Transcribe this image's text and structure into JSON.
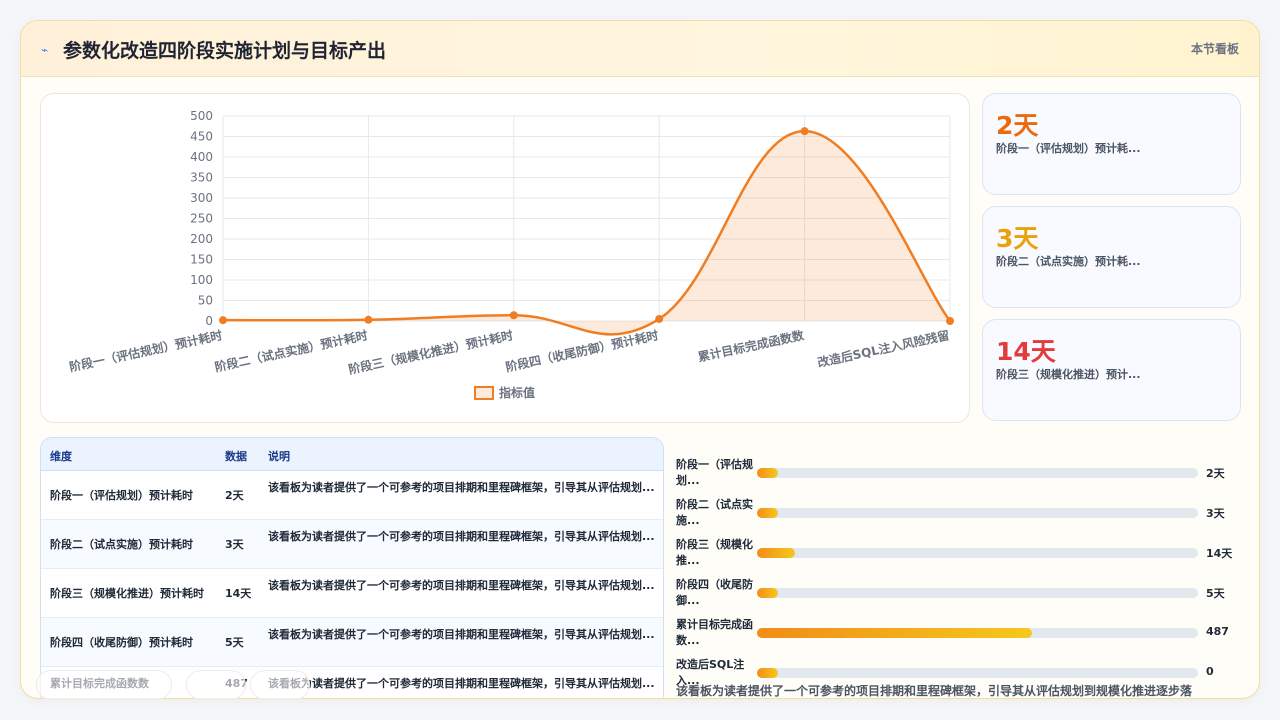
{
  "header": {
    "icon": "lightning-icon",
    "title": "参数化改造四阶段实施计划与目标产出",
    "right_label": "本节看板"
  },
  "chart_data": {
    "type": "line",
    "categories": [
      "阶段一（评估规划）预计耗时",
      "阶段二（试点实施）预计耗时",
      "阶段三（规模化推进）预计耗时",
      "阶段四（收尾防御）预计耗时",
      "累计目标完成函数数",
      "改造后SQL注入风险残留"
    ],
    "series": [
      {
        "name": "指标值",
        "values": [
          2,
          3,
          14,
          5,
          463,
          0
        ]
      }
    ],
    "yticks": [
      "0",
      "50",
      "100",
      "150",
      "200",
      "250",
      "300",
      "350",
      "400",
      "450",
      "500"
    ],
    "ylim": [
      0,
      500
    ],
    "grid": true,
    "legend": "bottom",
    "fill": "area",
    "color": "#f07d22"
  },
  "kpis": [
    {
      "value": "2天",
      "label": "阶段一（评估规划）预计耗...",
      "color": "#ea6a10"
    },
    {
      "value": "3天",
      "label": "阶段二（试点实施）预计耗...",
      "color": "#eaa20c"
    },
    {
      "value": "14天",
      "label": "阶段三（规模化推进）预计...",
      "color": "#e23b3b"
    }
  ],
  "table": {
    "headers": [
      "维度",
      "数据",
      "说明"
    ],
    "rows": [
      {
        "dim": "阶段一（评估规划）预计耗时",
        "val": "2天",
        "desc": "该看板为读者提供了一个可参考的项目排期和里程碑框架，引导其从评估规划..."
      },
      {
        "dim": "阶段二（试点实施）预计耗时",
        "val": "3天",
        "desc": "该看板为读者提供了一个可参考的项目排期和里程碑框架，引导其从评估规划..."
      },
      {
        "dim": "阶段三（规模化推进）预计耗时",
        "val": "14天",
        "desc": "该看板为读者提供了一个可参考的项目排期和里程碑框架，引导其从评估规划..."
      },
      {
        "dim": "阶段四（收尾防御）预计耗时",
        "val": "5天",
        "desc": "该看板为读者提供了一个可参考的项目排期和里程碑框架，引导其从评估规划..."
      },
      {
        "dim": "累计目标完成函数数",
        "val": "487",
        "desc": "该看板为读者提供了一个可参考的项目排期和里程碑框架，引导其从评估规划..."
      }
    ]
  },
  "bars": [
    {
      "label": "阶段一（评估规划...",
      "value": "2天",
      "fraction": 0.048
    },
    {
      "label": "阶段二（试点实施...",
      "value": "3天",
      "fraction": 0.048
    },
    {
      "label": "阶段三（规模化推...",
      "value": "14天",
      "fraction": 0.086
    },
    {
      "label": "阶段四（收尾防御...",
      "value": "5天",
      "fraction": 0.048
    },
    {
      "label": "累计目标完成函数...",
      "value": "487",
      "fraction": 0.624
    },
    {
      "label": "改造后SQL注入...",
      "value": "0",
      "fraction": 0.048
    }
  ],
  "summary": "该看板为读者提供了一个可参考的项目排期和里程碑框架，引导其从评估规划到规模化推进逐步落"
}
